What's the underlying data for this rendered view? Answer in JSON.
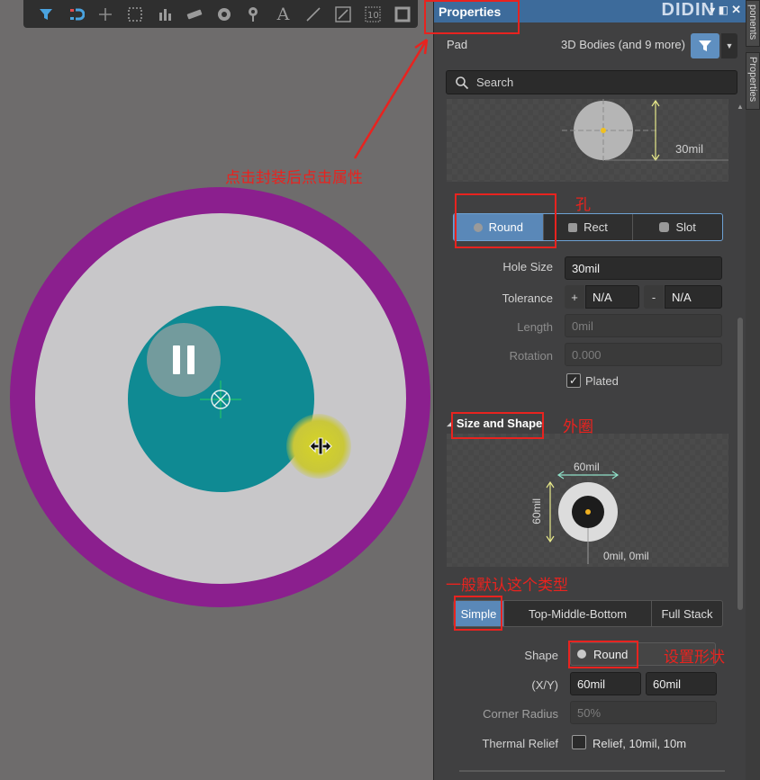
{
  "toolbar": {
    "tools": [
      "filter-icon",
      "magnet-icon",
      "crosshair-icon",
      "select-rect-icon",
      "bar-chart-icon",
      "component-icon",
      "target-icon",
      "pin-icon",
      "text-icon",
      "line-icon",
      "route-icon",
      "counter-icon",
      "square-icon"
    ],
    "text_tool_glyph": "A",
    "counter_tool_glyph": "10"
  },
  "canvas": {
    "colors": {
      "outer_ring": "#8b1f8e",
      "pad": "#c8c7c9",
      "drill": "#0f8a93"
    }
  },
  "annotations": {
    "click_hint": "点击封装后点击属性",
    "hole_label": "孔",
    "outer_label": "外圈",
    "default_type": "一般默认这个类型",
    "set_shape": "设置形状"
  },
  "panel": {
    "title": "Properties",
    "header_deco": "DIDIN",
    "pin_glyph": "▾ ◧",
    "close_glyph": "✕",
    "object_type": "Pad",
    "object_filter": "3D Bodies (and 9 more)",
    "search_placeholder": "Search",
    "hole_preview_dim": "30mil",
    "hole_shapes": [
      "Round",
      "Rect",
      "Slot"
    ],
    "hole_size_label": "Hole Size",
    "hole_size_value": "30mil",
    "tolerance_label": "Tolerance",
    "tolerance_plus_sign": "+",
    "tolerance_minus_sign": "-",
    "tolerance_plus": "N/A",
    "tolerance_minus": "N/A",
    "length_label": "Length",
    "length_value": "0mil",
    "rotation_label": "Rotation",
    "rotation_value": "0.000",
    "plated_label": "Plated",
    "plated_checked": true,
    "check_glyph": "✓",
    "size_shape_title": "Size and Shape",
    "shape_preview": {
      "width_dim": "60mil",
      "height_dim": "60mil",
      "offset": "0mil, 0mil"
    },
    "stack_modes": [
      "Simple",
      "Top-Middle-Bottom",
      "Full Stack"
    ],
    "shape_label": "Shape",
    "shape_value": "Round",
    "xy_label": "(X/Y)",
    "x_value": "60mil",
    "y_value": "60mil",
    "corner_radius_label": "Corner Radius",
    "corner_radius_value": "50%",
    "thermal_relief_label": "Thermal Relief",
    "thermal_relief_value": "Relief, 10mil, 10m"
  },
  "side_tabs": [
    "ponents",
    "Properties"
  ]
}
